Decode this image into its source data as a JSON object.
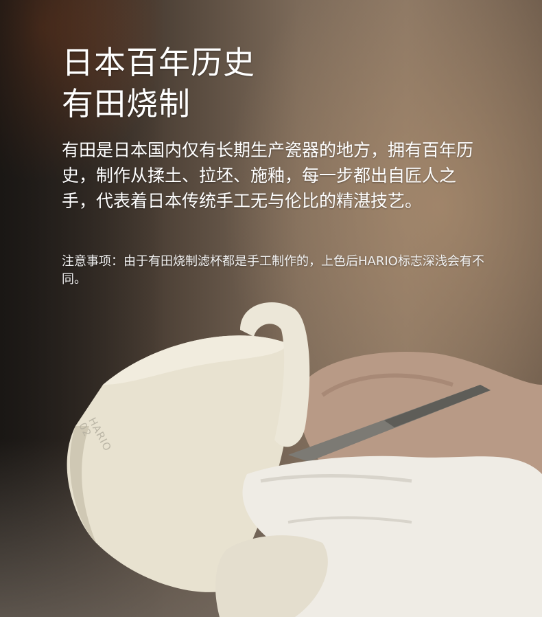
{
  "heading": {
    "line1": "日本百年历史",
    "line2": "有田烧制"
  },
  "description": "有田是日本国内仅有长期生产瓷器的地方，拥有百年历史，制作从揉土、拉坯、施釉，每一步都出自匠人之手，代表着日本传统手工无与伦比的精湛技艺。",
  "notice": "注意事项：由于有田烧制滤杯都是手工制作的，上色后HARIO标志深浅会有不同。",
  "product_logo": {
    "brand": "HARIO",
    "model": "02"
  },
  "colors": {
    "text": "#ffffff",
    "ceramic": "#e9e3d2",
    "glove": "#f0eee8"
  }
}
